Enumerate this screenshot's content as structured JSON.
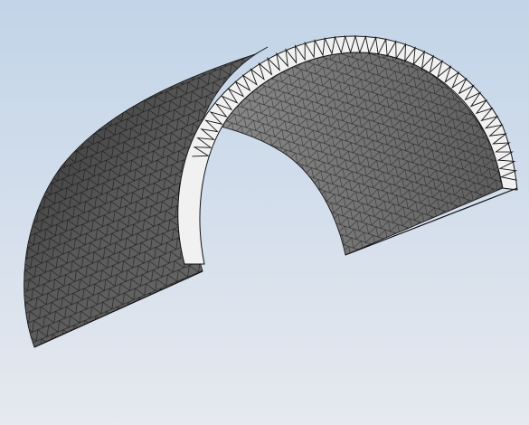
{
  "viewport": {
    "background_top": "#c2d4e8",
    "background_bottom": "#e6e9ef",
    "icon": "mesh-icon"
  },
  "model": {
    "description_visible": false,
    "mesh_type": "triangular",
    "shape": "half-cylinder shell",
    "colors": {
      "outer_surface": "#595959",
      "inner_surface": "#7a7a7a",
      "end_face": "#f1f1f1",
      "mesh_line": "#111111"
    }
  }
}
